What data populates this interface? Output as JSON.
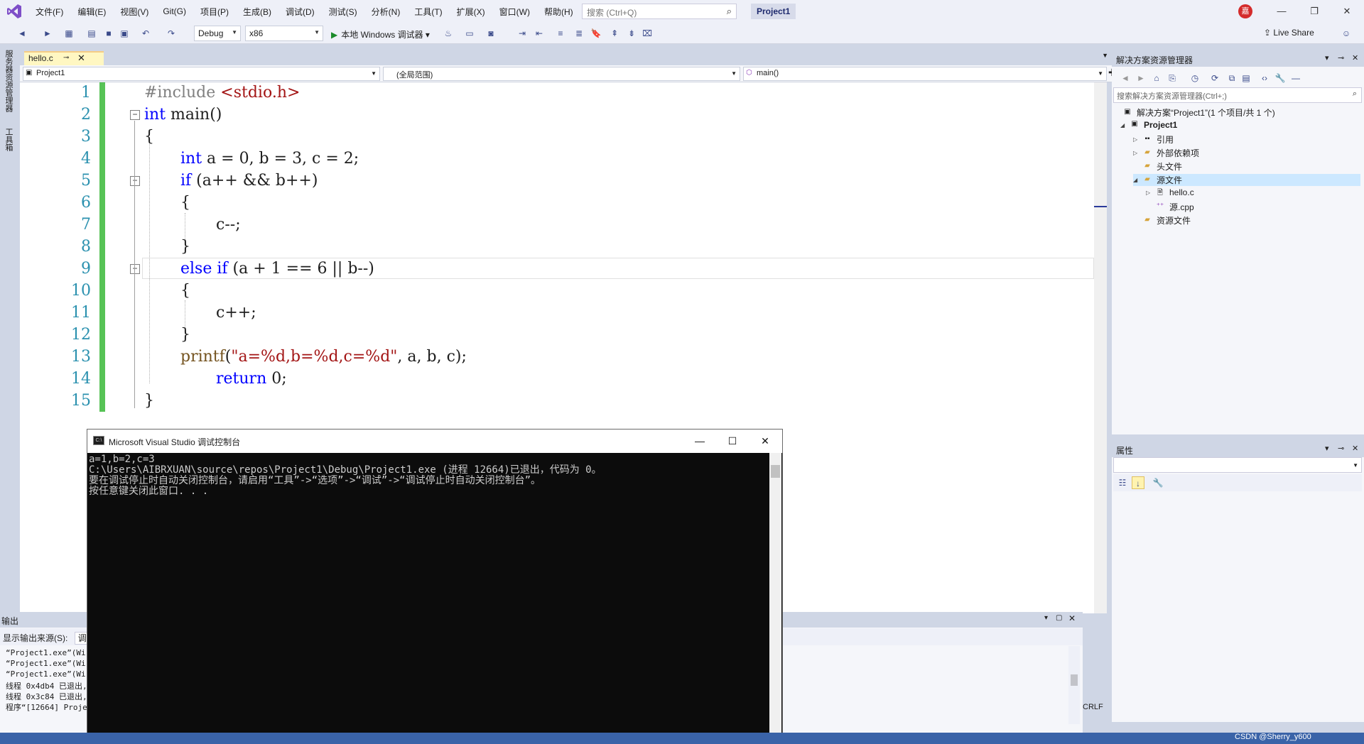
{
  "menubar": {
    "items": [
      "文件(F)",
      "编辑(E)",
      "视图(V)",
      "Git(G)",
      "项目(P)",
      "生成(B)",
      "调试(D)",
      "测试(S)",
      "分析(N)",
      "工具(T)",
      "扩展(X)",
      "窗口(W)",
      "帮助(H)"
    ],
    "search_placeholder": "搜索 (Ctrl+Q)",
    "project_title": "Project1",
    "user_initial": "嘉"
  },
  "toolbar": {
    "config": "Debug",
    "platform": "x86",
    "run_label": "本地 Windows 调试器",
    "live_share": "Live Share"
  },
  "side_tabs": [
    "服务器资源管理器",
    "工具箱"
  ],
  "doc_tab": {
    "name": "hello.c"
  },
  "navbar": {
    "project": "Project1",
    "scope": "(全局范围)",
    "member": "main()"
  },
  "editor": {
    "line_numbers": [
      "1",
      "2",
      "3",
      "4",
      "5",
      "6",
      "7",
      "8",
      "9",
      "10",
      "11",
      "12",
      "13",
      "14",
      "15"
    ]
  },
  "solution_explorer": {
    "title": "解决方案资源管理器",
    "search_placeholder": "搜索解决方案资源管理器(Ctrl+;)",
    "items": [
      "解决方案“Project1”(1 个项目/共 1 个)",
      "Project1",
      "引用",
      "外部依赖项",
      "头文件",
      "源文件",
      "hello.c",
      "源.cpp",
      "资源文件"
    ]
  },
  "properties": {
    "title": "属性"
  },
  "output": {
    "title": "输出",
    "source_label": "显示输出来源(S):",
    "source_value": "调试",
    "lines": [
      "“Project1.exe”(Wi",
      "“Project1.exe”(Wi",
      "“Project1.exe”(Wi",
      "线程 0x4db4 已退出,",
      "线程 0x3c84 已退出,",
      "程序“[12664] Proje"
    ],
    "crlf": "CRLF"
  },
  "console": {
    "title": "Microsoft Visual Studio 调试控制台",
    "icon_text": "C:\\",
    "lines": [
      "a=1,b=2,c=3",
      "C:\\Users\\AIBRXUAN\\source\\repos\\Project1\\Debug\\Project1.exe (进程 12664)已退出，代码为 0。",
      "要在调试停止时自动关闭控制台，请启用“工具”->“选项”->“调试”->“调试停止时自动关闭控制台”。",
      "按任意键关闭此窗口. . ."
    ]
  },
  "status": {
    "watermark": "CSDN @Sherry_y600"
  }
}
